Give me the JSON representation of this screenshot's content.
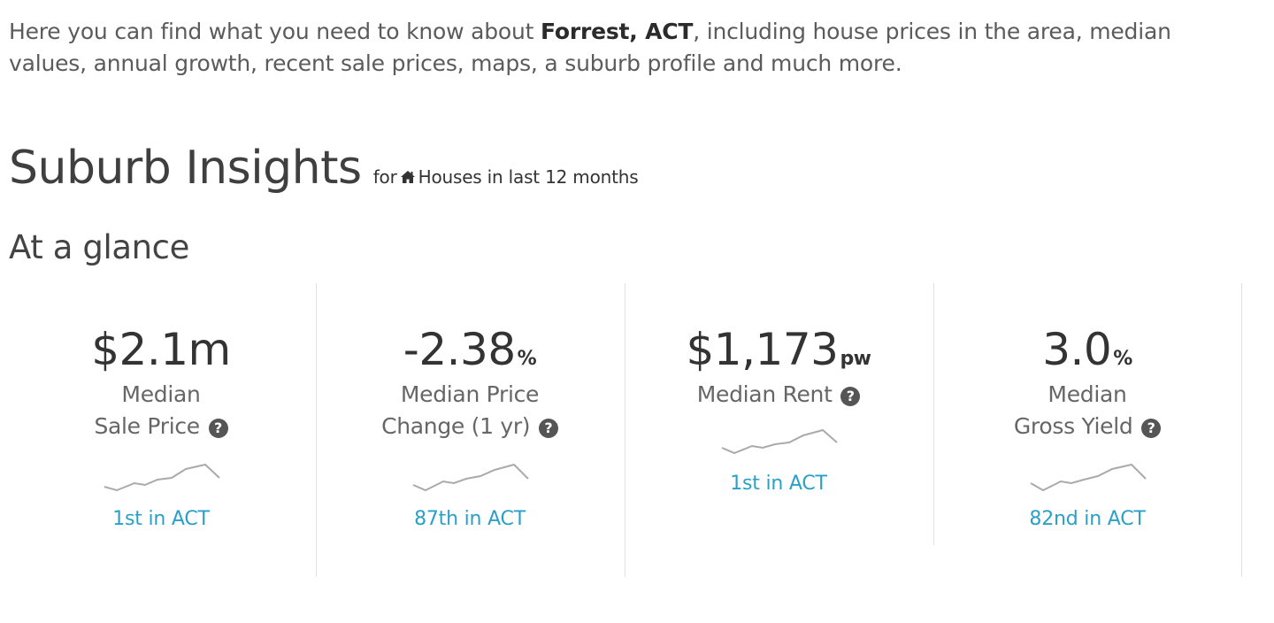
{
  "intro": {
    "text_before": "Here you can find what you need to know about ",
    "suburb": "Forrest, ACT",
    "text_after": ", including house prices in the area, median values, annual growth, recent sale prices, maps, a suburb profile and much more."
  },
  "heading": {
    "title": "Suburb Insights",
    "for_label": "for",
    "icon": "home-icon",
    "scope": "Houses in last 12 months"
  },
  "glance_title": "At a glance",
  "stats": [
    {
      "value": "$2.1m",
      "unit": "",
      "label_line1": "Median",
      "label_line2": "Sale Price",
      "rank": "1st in ACT"
    },
    {
      "value": "-2.38",
      "unit": "%",
      "label_line1": "Median Price",
      "label_line2": "Change (1 yr)",
      "rank": "87th in ACT"
    },
    {
      "value": "$1,173",
      "unit": "pw",
      "label_line1": "Median Rent",
      "label_line2": "",
      "rank": "1st in ACT"
    },
    {
      "value": "3.0",
      "unit": "%",
      "label_line1": "Median",
      "label_line2": "Gross Yield",
      "rank": "82nd in ACT"
    }
  ],
  "help_icon_glyph": "?",
  "colors": {
    "link": "#2aa0c8",
    "divider": "#e2e2e2",
    "sparkline": "#aaaaaa"
  }
}
